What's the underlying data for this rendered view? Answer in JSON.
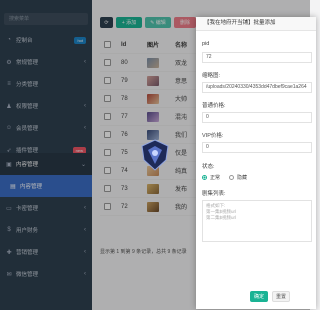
{
  "sidebar": {
    "search_placeholder": "搜索菜单",
    "items": [
      {
        "label": "控制台",
        "icon": "dashboard-icon",
        "badge": "hot"
      },
      {
        "label": "常规管理",
        "icon": "cog-icon"
      },
      {
        "label": "分类管理",
        "icon": "list-icon"
      },
      {
        "label": "权限管理",
        "icon": "group-icon"
      },
      {
        "label": "会员管理",
        "icon": "user-icon"
      },
      {
        "label": "插件管理",
        "icon": "rocket-icon"
      },
      {
        "label": "内容管理",
        "icon": "folder-icon"
      },
      {
        "label": "内容管理",
        "icon": "file-icon"
      },
      {
        "label": "卡密管理",
        "icon": "card-icon"
      },
      {
        "label": "用户财务",
        "icon": "dollar-icon"
      },
      {
        "label": "营销管理",
        "icon": "gift-icon"
      },
      {
        "label": "微信管理",
        "icon": "wechat-icon"
      }
    ]
  },
  "toolbar": {
    "add_label": "+ 添加",
    "edit_label": "✎ 编辑",
    "delete_label": "删除"
  },
  "table": {
    "headers": [
      "Id",
      "图片",
      "名称"
    ],
    "rows": [
      {
        "id": "80",
        "name": "双龙"
      },
      {
        "id": "79",
        "name": "意思"
      },
      {
        "id": "78",
        "name": "大帅"
      },
      {
        "id": "77",
        "name": "混沌"
      },
      {
        "id": "76",
        "name": "我们"
      },
      {
        "id": "75",
        "name": "仅是"
      },
      {
        "id": "74",
        "name": "纯真"
      },
      {
        "id": "73",
        "name": "发布"
      },
      {
        "id": "72",
        "name": "我的"
      }
    ],
    "footer": "显示第 1 到第 9 条记录，总共 9 条记录"
  },
  "modal": {
    "title": "【我在地府开当铺】批量添加",
    "pid_label": "pid",
    "pid_value": "72",
    "thumb_label": "缩略图:",
    "thumb_value": "/uploads/20240330/4353dd47dbef9cae1a264",
    "price_label": "普通价格:",
    "price_value": "0",
    "vip_label": "VIP价格:",
    "vip_value": "0",
    "status_label": "状态:",
    "status_normal": "正常",
    "status_hidden": "隐藏",
    "episodes_label": "剧集列表:",
    "episodes_placeholder": [
      "格式如下:",
      "第一集$视频url",
      "第二集$视频url"
    ],
    "ok_label": "确定",
    "reset_label": "重置"
  },
  "colors": {
    "sidebar_bg": "#2f4050",
    "active_item": "#3b6cc4",
    "primary": "#1ab394",
    "danger": "#ed5565"
  }
}
